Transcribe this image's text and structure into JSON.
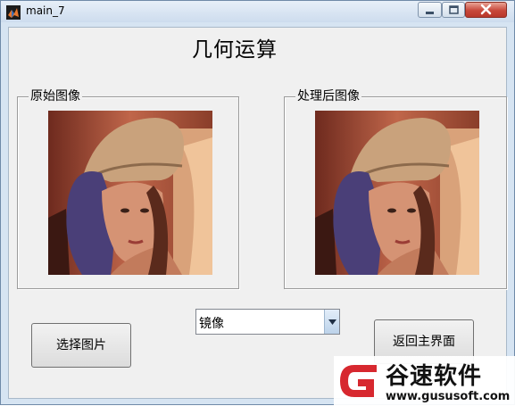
{
  "window": {
    "title": "main_7"
  },
  "heading": "几何运算",
  "panels": {
    "original_title": "原始图像",
    "processed_title": "处理后图像"
  },
  "buttons": {
    "select_image": "选择图片",
    "return_main": "返回主界面"
  },
  "operation_select": {
    "value": "镜像"
  },
  "watermark": {
    "name": "谷速软件",
    "url": "www.gususoft.com"
  },
  "colors": {
    "close_button": "#c8473a",
    "watermark_logo_red": "#d7282f",
    "client_background": "#f0f0f0"
  },
  "icons": {
    "app": "matlab-logo-icon",
    "minimize": "minimize-icon",
    "maximize": "maximize-icon",
    "close": "close-icon",
    "dropdown": "chevron-down-icon",
    "watermark_logo": "gusu-logo-icon"
  }
}
